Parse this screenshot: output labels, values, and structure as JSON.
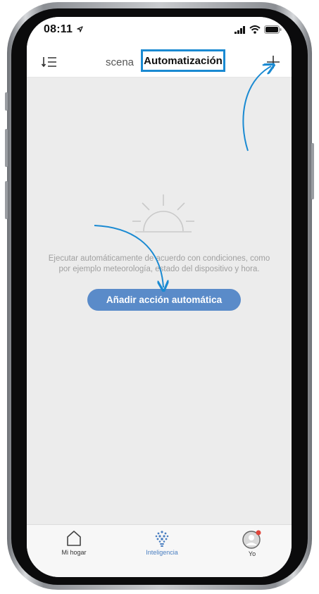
{
  "status_bar": {
    "time": "08:11"
  },
  "header": {
    "tabs": [
      {
        "label": "scena",
        "selected": false
      },
      {
        "label": "Automatización",
        "selected": true
      }
    ],
    "sort_icon": "sort-list-icon",
    "add_icon": "plus-icon"
  },
  "empty_state": {
    "illustration": "sunrise-icon",
    "description_lines": [
      "Ejecutar automáticamente de acuerdo con condiciones, como",
      "por ejemplo meteorología, estado del dispositivo y hora."
    ],
    "button_label": "Añadir acción automática"
  },
  "tab_bar": {
    "items": [
      {
        "label": "Mi hogar",
        "icon": "home-icon",
        "active": false
      },
      {
        "label": "Inteligencia",
        "icon": "smart-bulb-icon",
        "active": true
      },
      {
        "label": "Yo",
        "icon": "user-avatar-icon",
        "active": false
      }
    ]
  },
  "colors": {
    "highlight_frame": "#1a8ad2",
    "arrow": "#1a8ad2",
    "primary_button": "#5a8bc9",
    "active_tab": "#4a7fc1",
    "notification_dot": "#e0453a"
  }
}
